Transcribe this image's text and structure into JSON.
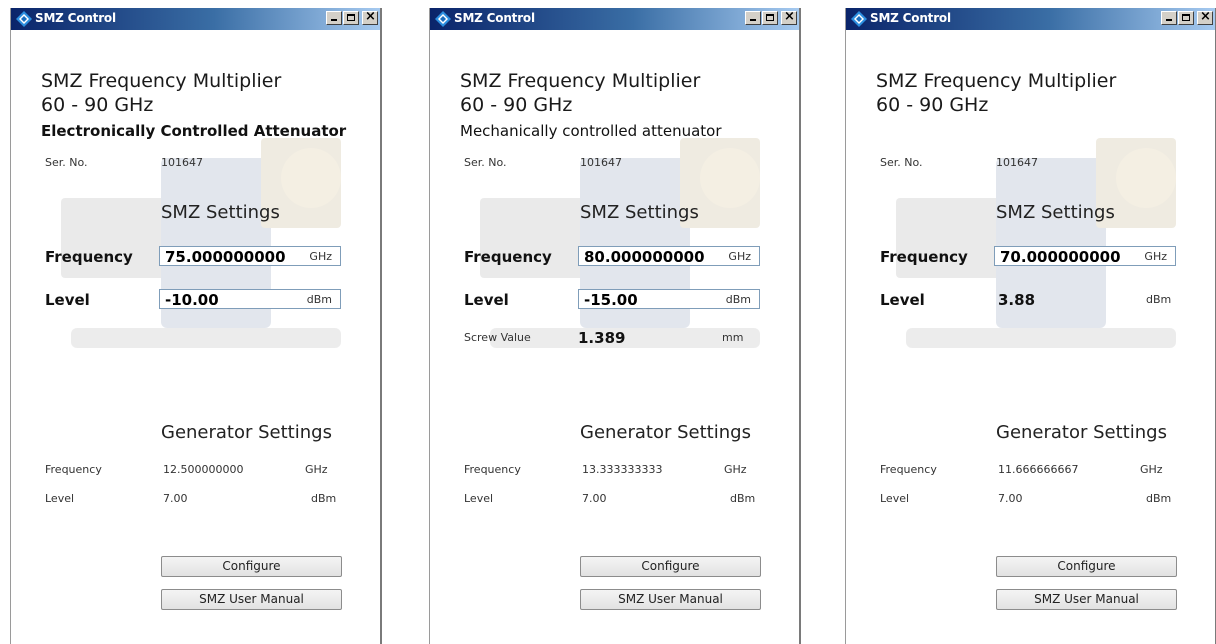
{
  "windows": [
    {
      "title": "SMZ Control",
      "product": "SMZ Frequency Multiplier",
      "range": "60 - 90 GHz",
      "attenuator": "Electronically Controlled Attenuator",
      "serial_label": "Ser. No.",
      "serial": "101647",
      "smz_heading": "SMZ Settings",
      "freq_label": "Frequency",
      "freq_value": "75.000000000",
      "freq_unit": "GHz",
      "level_label": "Level",
      "level_value": "-10.00",
      "level_unit": "dBm",
      "level_editable": true,
      "screw_label": "",
      "screw_value": "",
      "screw_unit": "",
      "gen_heading": "Generator Settings",
      "gen_freq_label": "Frequency",
      "gen_freq_value": "12.500000000",
      "gen_freq_unit": "GHz",
      "gen_level_label": "Level",
      "gen_level_value": "7.00",
      "gen_level_unit": "dBm",
      "configure": "Configure",
      "manual": "SMZ User Manual"
    },
    {
      "title": "SMZ Control",
      "product": "SMZ Frequency Multiplier",
      "range": "60 - 90 GHz",
      "attenuator": "Mechanically controlled attenuator",
      "serial_label": "Ser. No.",
      "serial": "101647",
      "smz_heading": "SMZ Settings",
      "freq_label": "Frequency",
      "freq_value": "80.000000000",
      "freq_unit": "GHz",
      "level_label": "Level",
      "level_value": "-15.00",
      "level_unit": "dBm",
      "level_editable": true,
      "screw_label": "Screw Value",
      "screw_value": "1.389",
      "screw_unit": "mm",
      "gen_heading": "Generator Settings",
      "gen_freq_label": "Frequency",
      "gen_freq_value": "13.333333333",
      "gen_freq_unit": "GHz",
      "gen_level_label": "Level",
      "gen_level_value": "7.00",
      "gen_level_unit": "dBm",
      "configure": "Configure",
      "manual": "SMZ User Manual"
    },
    {
      "title": "SMZ Control",
      "product": "SMZ Frequency Multiplier",
      "range": "60 - 90 GHz",
      "attenuator": "",
      "serial_label": "Ser. No.",
      "serial": "101647",
      "smz_heading": "SMZ Settings",
      "freq_label": "Frequency",
      "freq_value": "70.000000000",
      "freq_unit": "GHz",
      "level_label": "Level",
      "level_value": "3.88",
      "level_unit": "dBm",
      "level_editable": false,
      "screw_label": "",
      "screw_value": "",
      "screw_unit": "",
      "gen_heading": "Generator Settings",
      "gen_freq_label": "Frequency",
      "gen_freq_value": "11.666666667",
      "gen_freq_unit": "GHz",
      "gen_level_label": "Level",
      "gen_level_value": "7.00",
      "gen_level_unit": "dBm",
      "configure": "Configure",
      "manual": "SMZ User Manual"
    }
  ],
  "colors": {
    "titlebar_start": "#0a246a",
    "titlebar_end": "#a6caf0",
    "field_border": "#7f9db9"
  }
}
